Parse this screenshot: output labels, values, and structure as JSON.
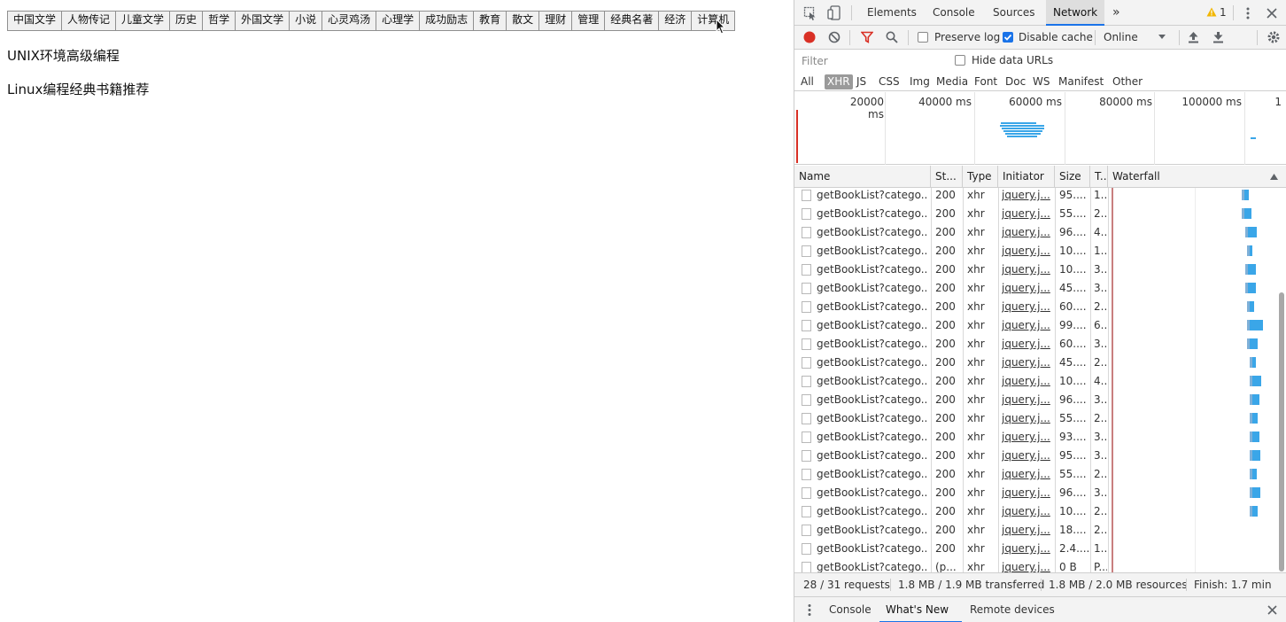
{
  "page": {
    "categories": [
      "中国文学",
      "人物传记",
      "儿童文学",
      "历史",
      "哲学",
      "外国文学",
      "小说",
      "心灵鸡汤",
      "心理学",
      "成功励志",
      "教育",
      "散文",
      "理财",
      "管理",
      "经典名著",
      "经济",
      "计算机"
    ],
    "books": [
      "UNIX环境高级编程",
      "Linux编程经典书籍推荐"
    ]
  },
  "devtools": {
    "tabs": [
      "Elements",
      "Console",
      "Sources",
      "Network"
    ],
    "active_tab": "Network",
    "more_tabs": "»",
    "warnings_count": "1",
    "toolbar": {
      "preserve_log": "Preserve log",
      "disable_cache": "Disable cache",
      "throttle": "Online"
    },
    "filter_placeholder": "Filter",
    "hide_data_urls": "Hide data URLs",
    "filter_types": [
      "All",
      "XHR",
      "JS",
      "CSS",
      "Img",
      "Media",
      "Font",
      "Doc",
      "WS",
      "Manifest",
      "Other"
    ],
    "active_filter_type": "XHR",
    "overview_ticks": [
      "20000 ms",
      "40000 ms",
      "60000 ms",
      "80000 ms",
      "100000 ms",
      "1"
    ],
    "columns": [
      "Name",
      "St...",
      "Type",
      "Initiator",
      "Size",
      "T...",
      "Waterfall"
    ],
    "requests": [
      {
        "name": "getBookList?catego...",
        "status": "200",
        "type": "xhr",
        "initiator": "jquery.j...",
        "size": "95....",
        "time": "1...",
        "wf_start": 0.37,
        "wf_len": 0.02
      },
      {
        "name": "getBookList?catego...",
        "status": "200",
        "type": "xhr",
        "initiator": "jquery.j...",
        "size": "55....",
        "time": "2...",
        "wf_start": 0.37,
        "wf_len": 0.03
      },
      {
        "name": "getBookList?catego...",
        "status": "200",
        "type": "xhr",
        "initiator": "jquery.j...",
        "size": "96....",
        "time": "4...",
        "wf_start": 0.38,
        "wf_len": 0.04
      },
      {
        "name": "getBookList?catego...",
        "status": "200",
        "type": "xhr",
        "initiator": "jquery.j...",
        "size": "10....",
        "time": "1...",
        "wf_start": 0.385,
        "wf_len": 0.01
      },
      {
        "name": "getBookList?catego...",
        "status": "200",
        "type": "xhr",
        "initiator": "jquery.j...",
        "size": "10....",
        "time": "3...",
        "wf_start": 0.38,
        "wf_len": 0.035
      },
      {
        "name": "getBookList?catego...",
        "status": "200",
        "type": "xhr",
        "initiator": "jquery.j...",
        "size": "45....",
        "time": "3...",
        "wf_start": 0.38,
        "wf_len": 0.035
      },
      {
        "name": "getBookList?catego...",
        "status": "200",
        "type": "xhr",
        "initiator": "jquery.j...",
        "size": "60....",
        "time": "2...",
        "wf_start": 0.385,
        "wf_len": 0.02
      },
      {
        "name": "getBookList?catego...",
        "status": "200",
        "type": "xhr",
        "initiator": "jquery.j...",
        "size": "99....",
        "time": "6...",
        "wf_start": 0.385,
        "wf_len": 0.06
      },
      {
        "name": "getBookList?catego...",
        "status": "200",
        "type": "xhr",
        "initiator": "jquery.j...",
        "size": "60....",
        "time": "3...",
        "wf_start": 0.385,
        "wf_len": 0.035
      },
      {
        "name": "getBookList?catego...",
        "status": "200",
        "type": "xhr",
        "initiator": "jquery.j...",
        "size": "45....",
        "time": "2...",
        "wf_start": 0.39,
        "wf_len": 0.015
      },
      {
        "name": "getBookList?catego...",
        "status": "200",
        "type": "xhr",
        "initiator": "jquery.j...",
        "size": "10....",
        "time": "4...",
        "wf_start": 0.39,
        "wf_len": 0.04
      },
      {
        "name": "getBookList?catego...",
        "status": "200",
        "type": "xhr",
        "initiator": "jquery.j...",
        "size": "96....",
        "time": "3...",
        "wf_start": 0.39,
        "wf_len": 0.03
      },
      {
        "name": "getBookList?catego...",
        "status": "200",
        "type": "xhr",
        "initiator": "jquery.j...",
        "size": "55....",
        "time": "2...",
        "wf_start": 0.39,
        "wf_len": 0.025
      },
      {
        "name": "getBookList?catego...",
        "status": "200",
        "type": "xhr",
        "initiator": "jquery.j...",
        "size": "93....",
        "time": "3...",
        "wf_start": 0.39,
        "wf_len": 0.03
      },
      {
        "name": "getBookList?catego...",
        "status": "200",
        "type": "xhr",
        "initiator": "jquery.j...",
        "size": "95....",
        "time": "3...",
        "wf_start": 0.39,
        "wf_len": 0.035
      },
      {
        "name": "getBookList?catego...",
        "status": "200",
        "type": "xhr",
        "initiator": "jquery.j...",
        "size": "55....",
        "time": "2...",
        "wf_start": 0.39,
        "wf_len": 0.02
      },
      {
        "name": "getBookList?catego...",
        "status": "200",
        "type": "xhr",
        "initiator": "jquery.j...",
        "size": "96....",
        "time": "3...",
        "wf_start": 0.39,
        "wf_len": 0.035
      },
      {
        "name": "getBookList?catego...",
        "status": "200",
        "type": "xhr",
        "initiator": "jquery.j...",
        "size": "10....",
        "time": "2...",
        "wf_start": 0.39,
        "wf_len": 0.025
      },
      {
        "name": "getBookList?catego...",
        "status": "200",
        "type": "xhr",
        "initiator": "jquery.j...",
        "size": "18....",
        "time": "2...",
        "wf_start": 0.0,
        "wf_len": 0.0
      },
      {
        "name": "getBookList?catego...",
        "status": "200",
        "type": "xhr",
        "initiator": "jquery.j...",
        "size": "2.4....",
        "time": "1...",
        "wf_start": 0.0,
        "wf_len": 0.0
      },
      {
        "name": "getBookList?catego...",
        "status": "(p...",
        "type": "xhr",
        "initiator": "jquery.j...",
        "size": "0 B",
        "time": "P...",
        "wf_start": 0.0,
        "wf_len": 0.0
      }
    ],
    "status": {
      "requests": "28 / 31 requests",
      "transferred": "1.8 MB / 1.9 MB transferred",
      "resources": "1.8 MB / 2.0 MB resources",
      "finish": "Finish: 1.7 min"
    },
    "drawer_tabs": [
      "Console",
      "What's New",
      "Remote devices"
    ],
    "active_drawer_tab": "What's New",
    "colors": {
      "accent": "#1a73e8",
      "record": "#d93025",
      "bar": "#3aa6e8"
    }
  }
}
